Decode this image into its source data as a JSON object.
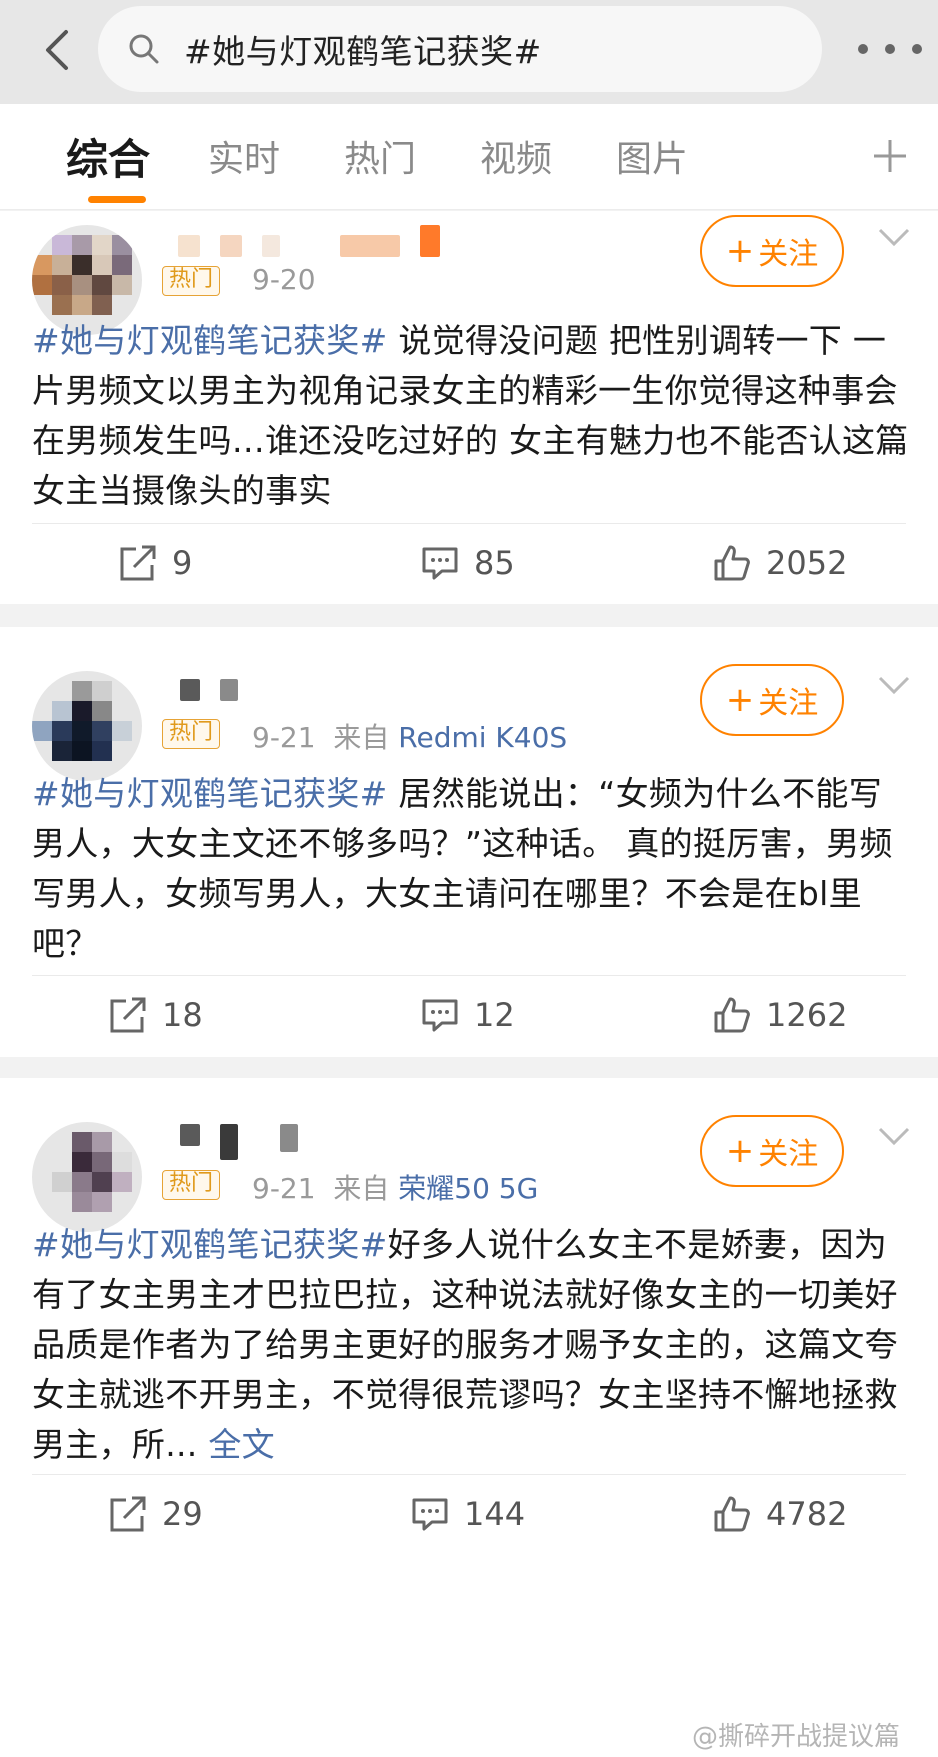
{
  "search": {
    "query": "#她与灯观鹤笔记获奖#"
  },
  "tabs": [
    "综合",
    "实时",
    "热门",
    "视频",
    "图片"
  ],
  "icons": {
    "back": "chevron-left-icon",
    "search": "search-icon",
    "more": "more-dots-icon",
    "plus": "plus-icon",
    "expand": "chevron-down-icon",
    "repost": "share-icon",
    "comment": "comment-icon",
    "like": "thumbs-up-icon"
  },
  "colors": {
    "accent": "#ff8200",
    "link": "#4a6ea8",
    "hot_badge": "#e09a1c"
  },
  "posts": [
    {
      "badge": "热门",
      "date": "9-20",
      "source_prefix": "",
      "source": "",
      "follow_label": "关注",
      "topic": "#她与灯观鹤笔记获奖#",
      "body": " 说觉得没问题 把性别调转一下 一片男频文以男主为视角记录女主的精彩一生你觉得这种事会在男频发生吗…谁还没吃过好的 女主有魅力也不能否认这篇女主当摄像头的事实",
      "more": "",
      "reposts": "9",
      "comments": "85",
      "likes": "2052"
    },
    {
      "badge": "热门",
      "date": "9-21",
      "source_prefix": "来自",
      "source": "Redmi K40S",
      "follow_label": "关注",
      "topic": "#她与灯观鹤笔记获奖#",
      "body": " 居然能说出：“女频为什么不能写男人，大女主文还不够多吗？”这种话。 真的挺厉害，男频写男人，女频写男人，大女主请问在哪里？不会是在bl里吧？",
      "more": "",
      "reposts": "18",
      "comments": "12",
      "likes": "1262"
    },
    {
      "badge": "热门",
      "date": "9-21",
      "source_prefix": "来自",
      "source": "荣耀50 5G",
      "follow_label": "关注",
      "topic": "#她与灯观鹤笔记获奖#",
      "body": "好多人说什么女主不是娇妻，因为有了女主男主才巴拉巴拉，这种说法就好像女主的一切美好品质是作者为了给男主更好的服务才赐予女主的，这篇文夸女主就逃不开男主，不觉得很荒谬吗？女主坚持不懈地拯救男主，所... ",
      "more": "全文",
      "reposts": "29",
      "comments": "144",
      "likes": "4782"
    }
  ],
  "watermark": "@撕碎开战提议篇"
}
